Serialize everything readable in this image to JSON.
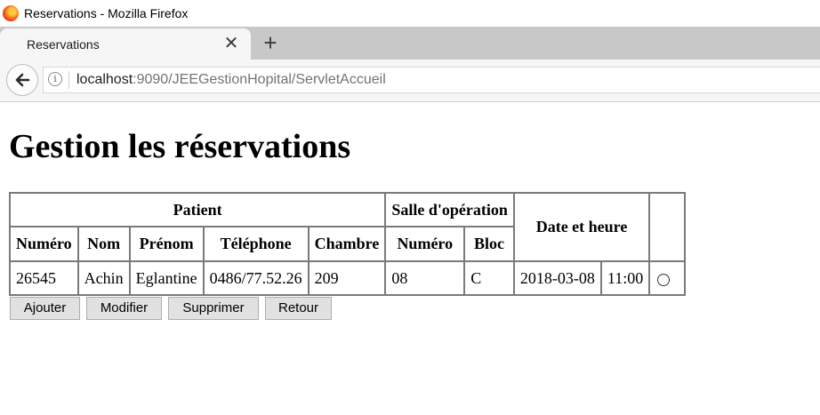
{
  "window": {
    "title": "Reservations - Mozilla Firefox"
  },
  "tab": {
    "label": "Reservations"
  },
  "url": {
    "host": "localhost",
    "rest": ":9090/JEEGestionHopital/ServletAccueil"
  },
  "page": {
    "heading": "Gestion les réservations"
  },
  "table": {
    "group_patient": "Patient",
    "group_salle": "Salle d'opération",
    "date_header": "Date et heure",
    "columns": [
      "Numéro",
      "Nom",
      "Prénom",
      "Téléphone",
      "Chambre",
      "Numéro",
      "Bloc"
    ],
    "rows": [
      [
        "26545",
        "Achin",
        "Eglantine",
        "0486/77.52.26",
        "209",
        "08",
        "C",
        "2018-03-08",
        "11:00"
      ]
    ]
  },
  "buttons": {
    "add": "Ajouter",
    "edit": "Modifier",
    "delete": "Supprimer",
    "back": "Retour"
  },
  "icons": {
    "close": "close-icon",
    "new_tab": "plus-icon",
    "back": "back-arrow-icon",
    "info": "info-icon"
  }
}
